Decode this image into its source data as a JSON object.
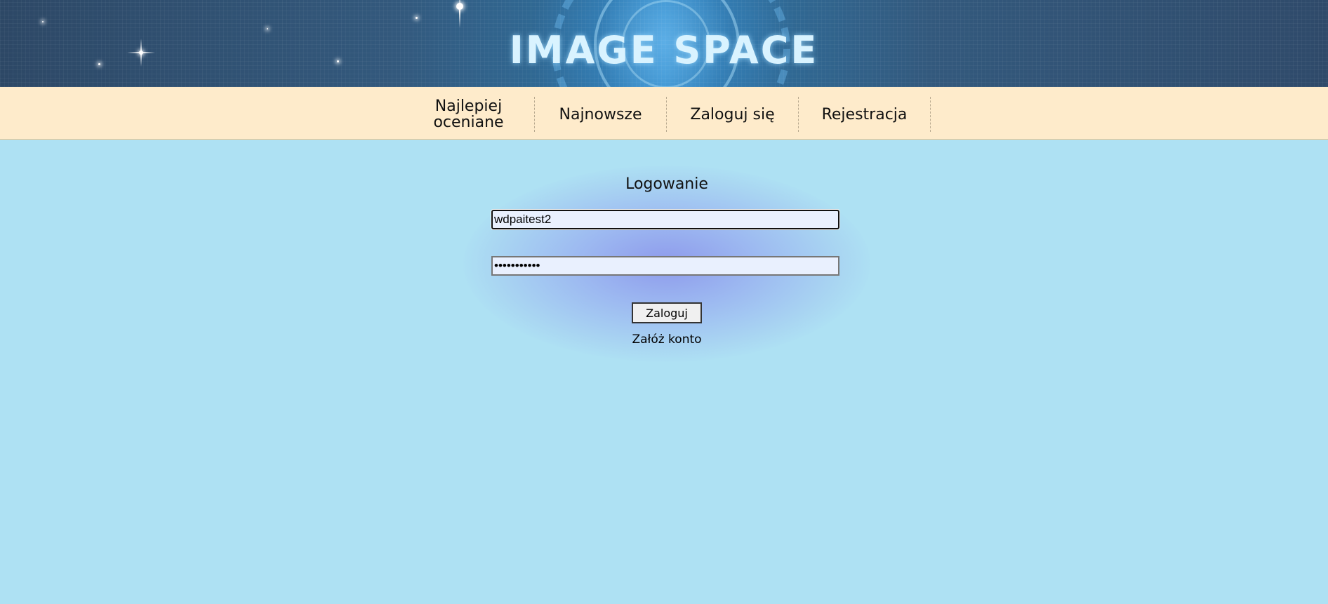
{
  "header": {
    "site_title": "IMAGE SPACE"
  },
  "nav": {
    "items": [
      {
        "label": "Najlepiej\noceniane"
      },
      {
        "label": "Najnowsze"
      },
      {
        "label": "Zaloguj się"
      },
      {
        "label": "Rejestracja"
      }
    ]
  },
  "login_form": {
    "title": "Logowanie",
    "login_value": "wdpaitest2",
    "password_value": "•••••••••••",
    "submit_label": "Zaloguj",
    "register_link": "Załóż konto"
  },
  "colors": {
    "page_background": "#aee1f3",
    "nav_background": "#feebcb",
    "field_background": "#e9f0fe"
  }
}
